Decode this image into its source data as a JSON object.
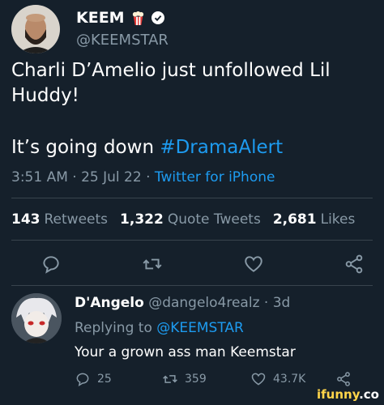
{
  "tweet": {
    "author_name": "KEEM",
    "author_emoji": "popcorn-icon",
    "author_handle": "@KEEMSTAR",
    "text_line1": "Charli D’Amelio just unfollowed Lil Huddy!",
    "text_line2_prefix": "It’s going down ",
    "hashtag": "#DramaAlert",
    "time": "3:51 AM",
    "date": "25 Jul 22",
    "source": "Twitter for iPhone",
    "separator": "·"
  },
  "stats": {
    "retweets_count": "143",
    "retweets_label": "Retweets",
    "quote_count": "1,322",
    "quote_label": "Quote Tweets",
    "likes_count": "2,681",
    "likes_label": "Likes"
  },
  "reply": {
    "author_name": "D'Angelo",
    "author_handle": "@dangelo4realz",
    "age": "3d",
    "replying_to_prefix": "Replying to ",
    "replying_to_handle": "@KEEMSTAR",
    "text": "Your a grown ass man Keemstar",
    "reply_count": "25",
    "retweet_count": "359",
    "like_count": "43.7K"
  },
  "watermark": {
    "brand": "ifunny",
    "suffix": ".co"
  },
  "colors": {
    "background": "#15202b",
    "muted": "#8899a6",
    "link": "#1d9bf0",
    "divider": "#38444d"
  }
}
